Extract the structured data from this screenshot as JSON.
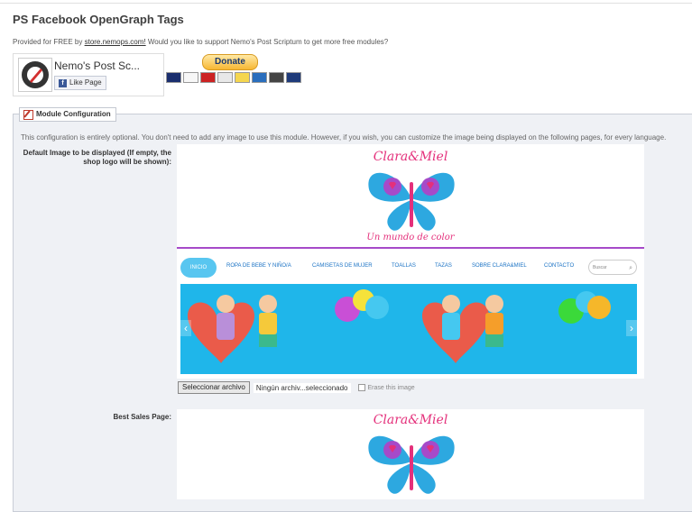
{
  "header": {
    "title": "PS Facebook OpenGraph Tags"
  },
  "provided": {
    "prefix": "Provided for FREE by ",
    "link": "store.nemops.com!",
    "suffix": " Would you like to support Nemo's Post Scriptum to get more free modules?"
  },
  "fb_widget": {
    "name": "Nemo's Post Sc...",
    "like_label": "Like Page"
  },
  "donate": {
    "label": "Donate",
    "card_icons": [
      "mastercard-icon",
      "visa-icon",
      "maestro-icon",
      "card-icon",
      "card-icon",
      "amex-icon",
      "card-icon",
      "card-icon"
    ]
  },
  "panel": {
    "title": "Module Configuration"
  },
  "config": {
    "description": "This configuration is entirely optional. You don't need to add any image to use this module. However, if you wish, you can customize the image being displayed on the following pages, for every language."
  },
  "fields": [
    {
      "label": "Default Image to be displayed (If empty, the shop logo will be shown):"
    },
    {
      "label": "Best Sales Page:"
    }
  ],
  "preview": {
    "brand_title": "Clara&Miel",
    "brand_tag": "Un mundo de color",
    "nav": [
      "INICIO",
      "ROPA DE BEBE Y NIÑO/A",
      "CAMISETAS DE MUJER",
      "TOALLAS",
      "TAZAS",
      "SOBRE CLARA&MIEL",
      "CONTACTO"
    ],
    "search_placeholder": "Buscar"
  },
  "file_input": {
    "button": "Seleccionar archivo",
    "filename": "Ningún archiv...seleccionado",
    "erase_label": "Erase this image"
  },
  "colors": {
    "accent_pink": "#e4307b",
    "nav_blue": "#58c6f0",
    "banner_blue": "#1fb6ea",
    "panel_bg": "#eff1f5"
  }
}
